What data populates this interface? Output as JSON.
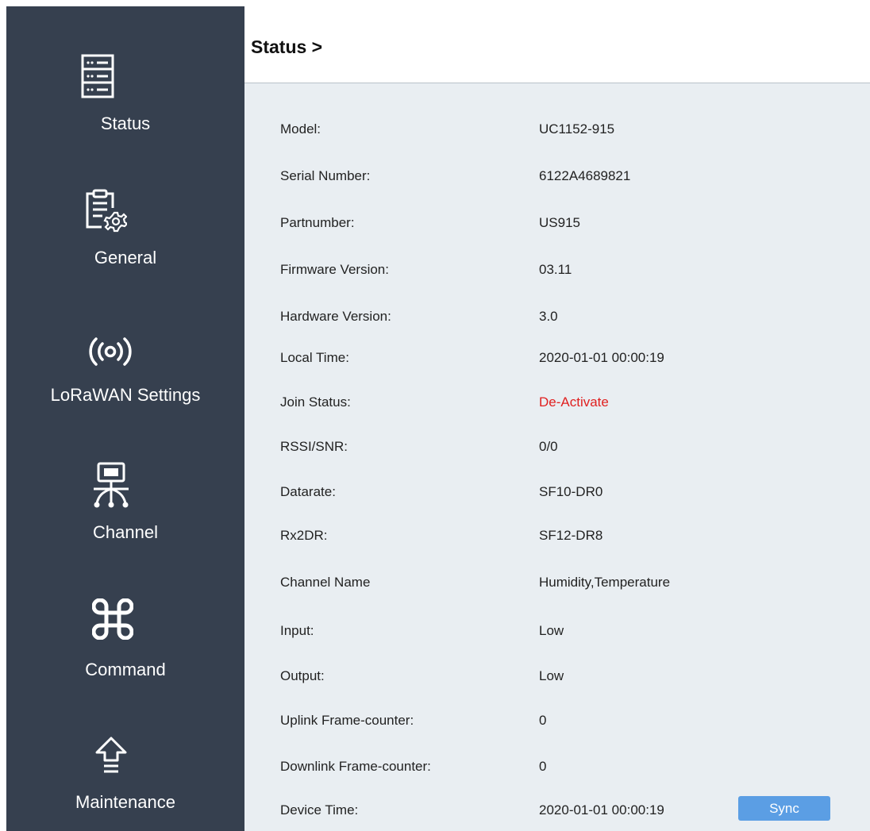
{
  "sidebar": {
    "items": [
      {
        "label": "Status",
        "icon": "server-icon"
      },
      {
        "label": "General",
        "icon": "clipboard-gear-icon"
      },
      {
        "label": "LoRaWAN Settings",
        "icon": "wireless-signal-icon"
      },
      {
        "label": "Channel",
        "icon": "channel-network-icon"
      },
      {
        "label": "Command",
        "icon": "command-key-icon"
      },
      {
        "label": "Maintenance",
        "icon": "upgrade-arrow-icon"
      }
    ]
  },
  "header": {
    "title": "Status >"
  },
  "status": {
    "rows": [
      {
        "label": "Model:",
        "value": "UC1152-915"
      },
      {
        "label": "Serial Number:",
        "value": "6122A4689821"
      },
      {
        "label": "Partnumber:",
        "value": "US915"
      },
      {
        "label": "Firmware Version:",
        "value": "03.11"
      },
      {
        "label": "Hardware Version:",
        "value": "3.0"
      },
      {
        "label": "Local Time:",
        "value": "2020-01-01 00:00:19"
      },
      {
        "label": "Join Status:",
        "value": "De-Activate"
      },
      {
        "label": "RSSI/SNR:",
        "value": "0/0"
      },
      {
        "label": "Datarate:",
        "value": "SF10-DR0"
      },
      {
        "label": "Rx2DR:",
        "value": "SF12-DR8"
      },
      {
        "label": "Channel Name",
        "value": "Humidity,Temperature"
      },
      {
        "label": "Input:",
        "value": "Low"
      },
      {
        "label": "Output:",
        "value": "Low"
      },
      {
        "label": "Uplink Frame-counter:",
        "value": "0"
      },
      {
        "label": "Downlink Frame-counter:",
        "value": "0"
      },
      {
        "label": "Device Time:",
        "value": "2020-01-01 00:00:19"
      }
    ],
    "sync_label": "Sync"
  },
  "colors": {
    "sidebar_bg": "#36404f",
    "content_bg": "#e9eef2",
    "alert_text": "#e02020",
    "button_bg": "#5b9ee4"
  }
}
